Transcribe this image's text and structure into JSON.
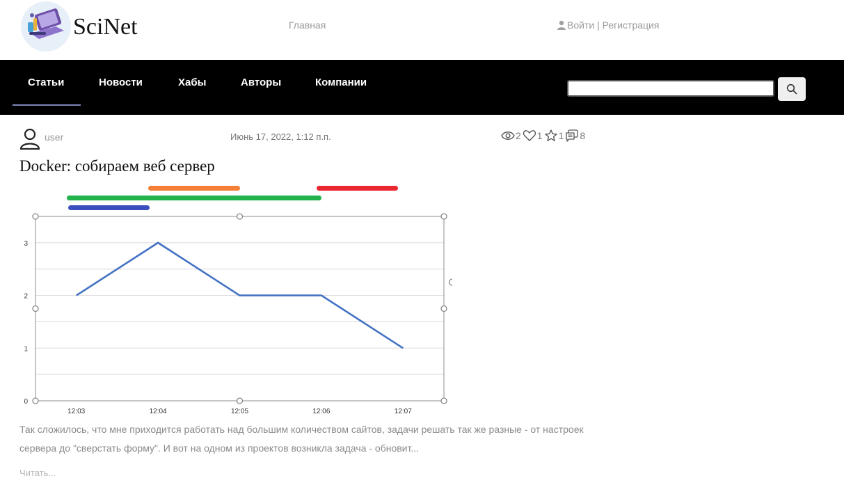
{
  "header": {
    "brand": "SciNet",
    "home_link": "Главная",
    "auth": {
      "login": "Войти",
      "separator": " | ",
      "register": "Регистрация"
    }
  },
  "nav": {
    "items": [
      {
        "label": "Статьи",
        "active": true
      },
      {
        "label": "Новости"
      },
      {
        "label": "Хабы"
      },
      {
        "label": "Авторы"
      },
      {
        "label": "Компании"
      }
    ],
    "search": {
      "value": "",
      "icon": "search-icon"
    }
  },
  "post": {
    "author": "user",
    "date": "Июнь 17, 2022, 1:12 п.п.",
    "stats": {
      "views": "2",
      "likes": "1",
      "favorites": "1",
      "comments": "8"
    },
    "title": "Docker: собираем веб сервер",
    "excerpt": "Так сложилось, что мне приходится работать над большим количеством сайтов, задачи решать так же разные - от настроек сервера до \"сверстать форму\". И вот на одном из проектов возникла задача - обновит...",
    "read_more": "Читать..."
  },
  "markers": [
    {
      "color": "#f47f35"
    },
    {
      "color": "#ea2630"
    },
    {
      "color": "#22b24c"
    },
    {
      "color": "#3d4fbf"
    }
  ],
  "chart_data": {
    "type": "line",
    "x": [
      "12:03",
      "12:04",
      "12:05",
      "12:06",
      "12:07"
    ],
    "series": [
      {
        "values": [
          2,
          3,
          2,
          2,
          1
        ],
        "color": "#4472c4"
      }
    ],
    "ylim": [
      0,
      3.5
    ],
    "yticks": [
      0,
      1,
      2,
      3
    ],
    "grid": true
  }
}
